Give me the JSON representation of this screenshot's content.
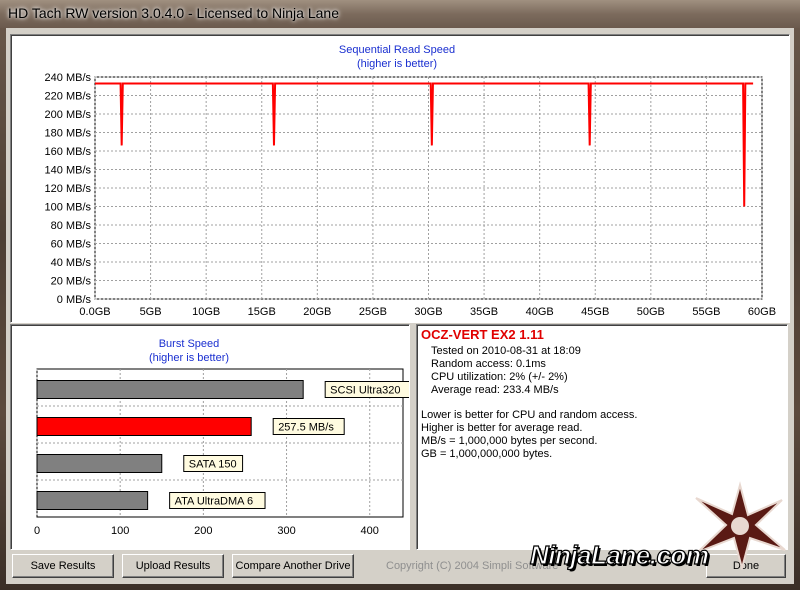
{
  "window": {
    "title": "HD Tach RW version 3.0.4.0 - Licensed to Ninja Lane"
  },
  "sequential": {
    "title": "Sequential Read Speed",
    "subtitle": "(higher is better)",
    "y_ticks": [
      "240 MB/s",
      "220 MB/s",
      "200 MB/s",
      "180 MB/s",
      "160 MB/s",
      "140 MB/s",
      "120 MB/s",
      "100 MB/s",
      "80 MB/s",
      "60 MB/s",
      "40 MB/s",
      "20 MB/s",
      "0 MB/s"
    ],
    "x_ticks": [
      "0.0GB",
      "5GB",
      "10GB",
      "15GB",
      "20GB",
      "25GB",
      "30GB",
      "35GB",
      "40GB",
      "45GB",
      "50GB",
      "55GB",
      "60GB"
    ],
    "line_color": "#ff0000"
  },
  "burst": {
    "title": "Burst Speed",
    "subtitle": "(higher is better)",
    "x_ticks": [
      "0",
      "100",
      "200",
      "300",
      "400"
    ]
  },
  "chart_data": [
    {
      "type": "line",
      "title": "Sequential Read Speed",
      "subtitle": "(higher is better)",
      "xlabel": "",
      "ylabel": "",
      "xlim": [
        0,
        60
      ],
      "ylim": [
        0,
        240
      ],
      "x_unit": "GB",
      "y_unit": "MB/s",
      "grid": true,
      "series": [
        {
          "color": "#ff0000",
          "x": [
            0,
            2.3,
            2.4,
            2.5,
            16.0,
            16.1,
            16.2,
            30.2,
            30.3,
            30.4,
            44.4,
            44.5,
            44.6,
            58.3,
            58.4,
            58.5,
            59.2
          ],
          "values": [
            233,
            233,
            166,
            233,
            233,
            166,
            233,
            233,
            166,
            233,
            233,
            166,
            233,
            233,
            100,
            233,
            233
          ]
        }
      ]
    },
    {
      "type": "bar",
      "orientation": "horizontal",
      "title": "Burst Speed",
      "subtitle": "(higher is better)",
      "categories": [
        "SCSI Ultra320",
        "257.5 MB/s",
        "SATA 150",
        "ATA UltraDMA 6"
      ],
      "values": [
        320,
        257.5,
        150,
        133
      ],
      "colors": [
        "#808080",
        "#ff0000",
        "#808080",
        "#808080"
      ],
      "xlim": [
        0,
        440
      ],
      "grid": true
    }
  ],
  "info": {
    "drive": "OCZ-VERT EX2 1.11",
    "tested": "Tested on 2010-08-31 at 18:09",
    "random_access": "Random access: 0.1ms",
    "cpu": "CPU utilization: 2% (+/- 2%)",
    "average": "Average read: 233.4 MB/s",
    "note1": "Lower is better for CPU and random access.",
    "note2": "Higher is better for average read.",
    "note3": "MB/s = 1,000,000 bytes per second.",
    "note4": "GB = 1,000,000,000 bytes."
  },
  "buttons": {
    "save": "Save Results",
    "upload": "Upload Results",
    "compare": "Compare Another Drive",
    "done": "Done"
  },
  "copyright": "Copyright (C) 2004 Simpli Software",
  "watermark": "NinjaLane.com"
}
